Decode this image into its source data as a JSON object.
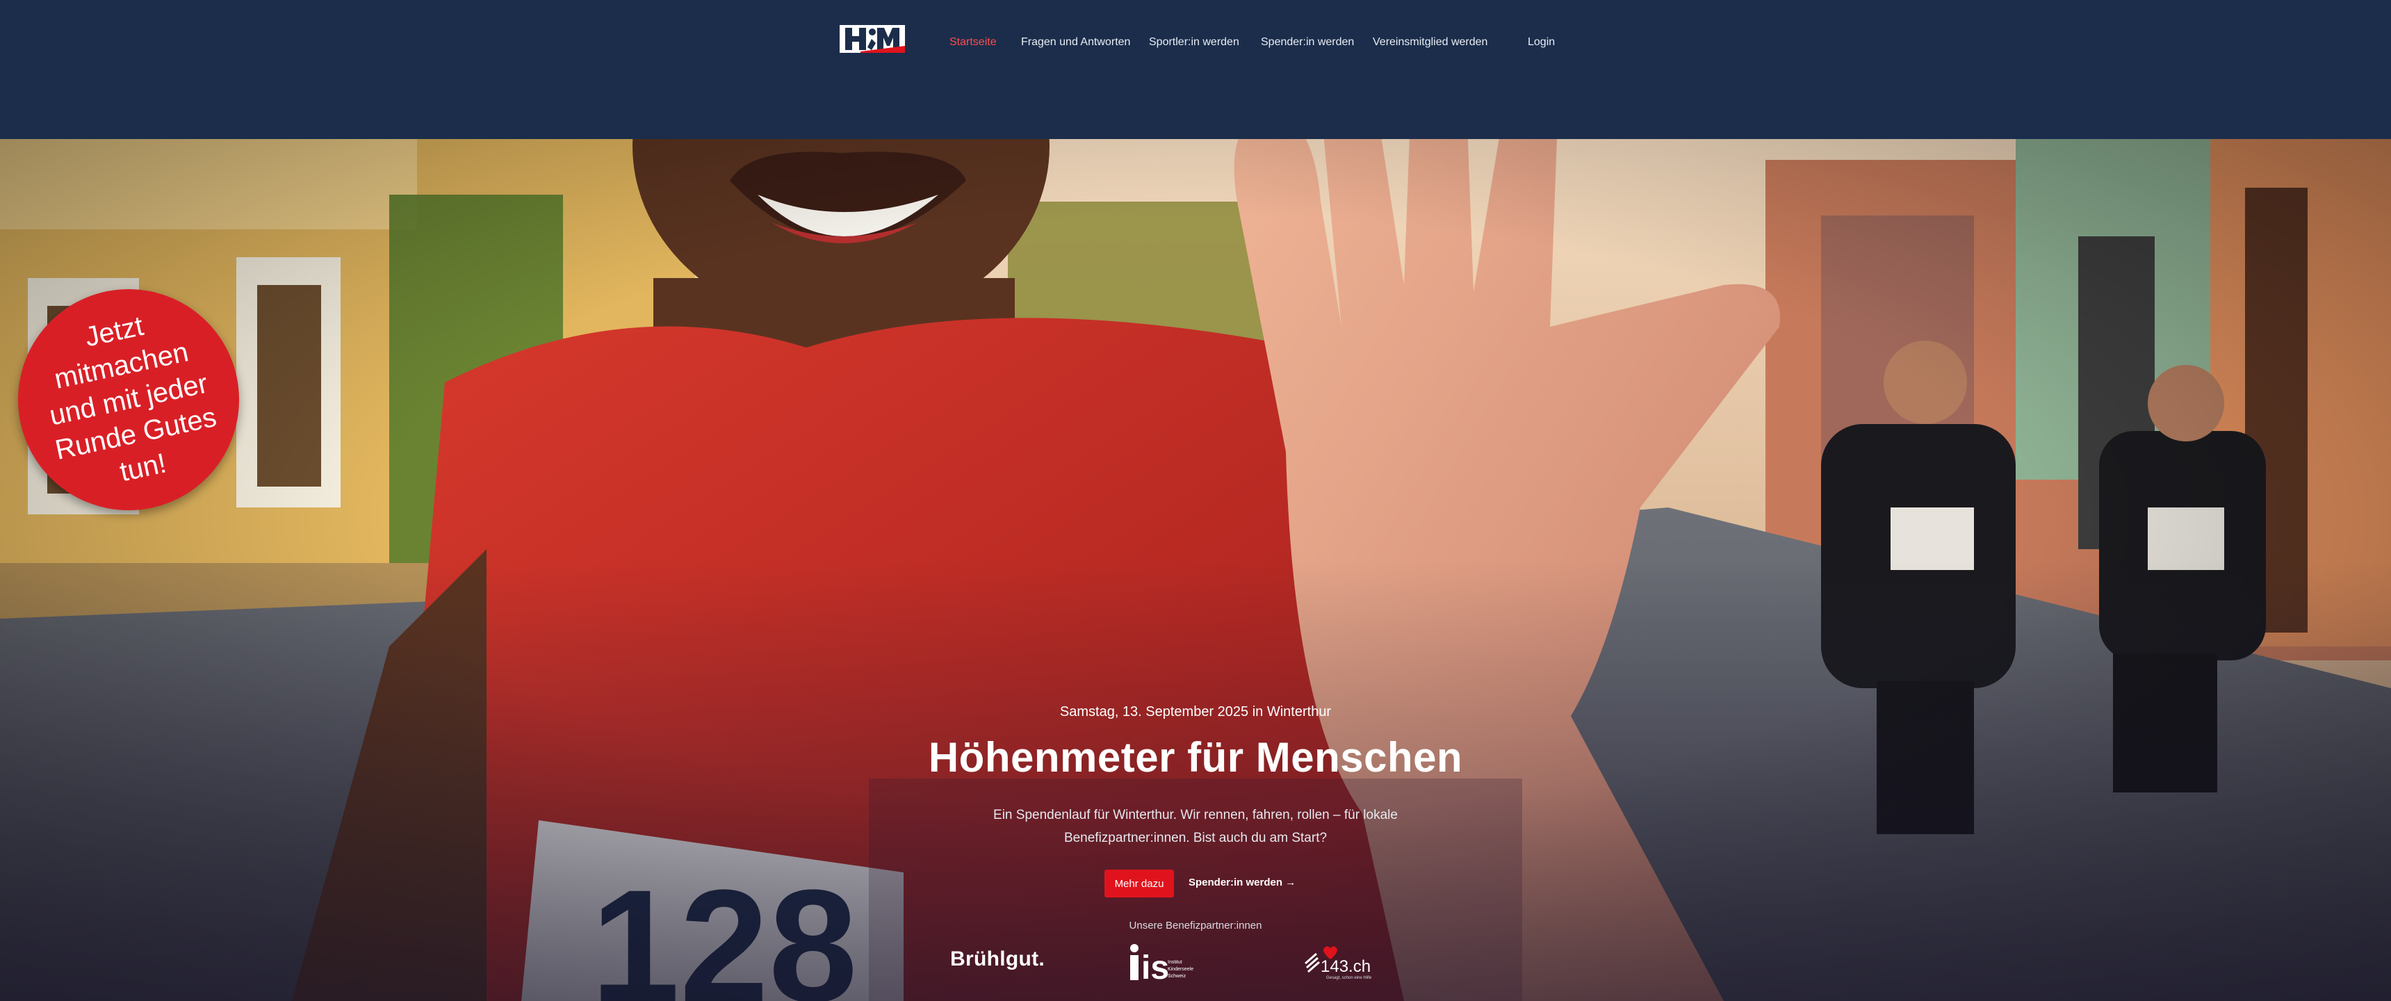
{
  "nav": {
    "logo_alt": "HfM",
    "items": [
      {
        "label": "Startseite",
        "active": true
      },
      {
        "label": "Fragen und Antworten",
        "active": false
      },
      {
        "label": "Sportler:in werden",
        "active": false
      },
      {
        "label": "Spender:in werden",
        "active": false
      },
      {
        "label": "Vereinsmitglied werden",
        "active": false
      }
    ],
    "login": "Login"
  },
  "sticker": {
    "text": "Jetzt mitmachen und mit jeder Runde Gutes tun!"
  },
  "hero": {
    "date": "Samstag, 13. September 2025 in Winterthur",
    "title": "Höhenmeter für Menschen",
    "subtitle": "Ein Spendenlauf für Winterthur. Wir rennen, fahren, rollen – für lokale Benefizpartner:innen. Bist auch du am Start?",
    "primary_button": "Mehr dazu",
    "secondary_link": "Spender:in werden →",
    "bib_number": "128"
  },
  "partners": {
    "label": "Unsere Benefizpartner:innen",
    "items": [
      {
        "name": "Brühlgut."
      },
      {
        "name": "is",
        "caption": "Institut Kinderseele Schweiz"
      },
      {
        "name": "143.ch",
        "caption": "Gesagt, schon eine Hilfe"
      }
    ]
  },
  "colors": {
    "nav_bg": "#1b2d4b",
    "accent": "#e0131d",
    "active_nav": "#ff4c4c",
    "sticker": "#d91f26"
  }
}
